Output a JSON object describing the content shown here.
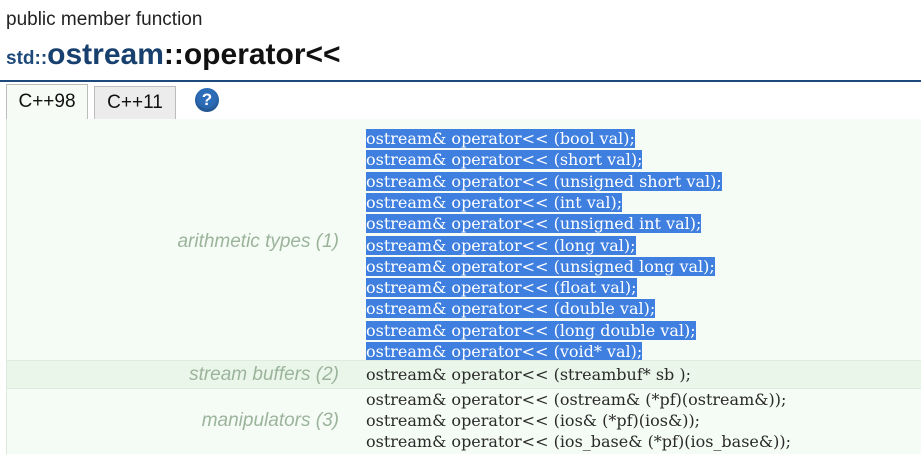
{
  "header": {
    "kind": "public member function",
    "namespace": "std::",
    "class_name": "ostream",
    "function_name": "::operator<<"
  },
  "tabs": [
    {
      "label": "C++98",
      "active": true
    },
    {
      "label": "C++11",
      "active": false
    }
  ],
  "help_icon": "?",
  "sections": {
    "arithmetic": {
      "label": "arithmetic types (1)",
      "lines": [
        "ostream& operator<< (bool val);",
        "ostream& operator<< (short val);",
        "ostream& operator<< (unsigned short val);",
        "ostream& operator<< (int val);",
        "ostream& operator<< (unsigned int val);",
        "ostream& operator<< (long val);",
        "ostream& operator<< (unsigned long val);",
        "ostream& operator<< (float val);",
        "ostream& operator<< (double val);",
        "ostream& operator<< (long double val);",
        "ostream& operator<< (void* val);"
      ]
    },
    "stream_buffers": {
      "label": "stream buffers (2)",
      "lines": [
        "ostream& operator<< (streambuf* sb );"
      ]
    },
    "manipulators": {
      "label": "manipulators (3)",
      "lines": [
        "ostream& operator<< (ostream& (*pf)(ostream&));",
        "ostream& operator<< (ios& (*pf)(ios&));",
        "ostream& operator<< (ios_base& (*pf)(ios_base&));"
      ]
    }
  },
  "colors": {
    "title_blue": "#17406e",
    "selection": "#3f7fdf",
    "panel_bg": "#f5fbf5",
    "category_text": "#9bb49b"
  }
}
